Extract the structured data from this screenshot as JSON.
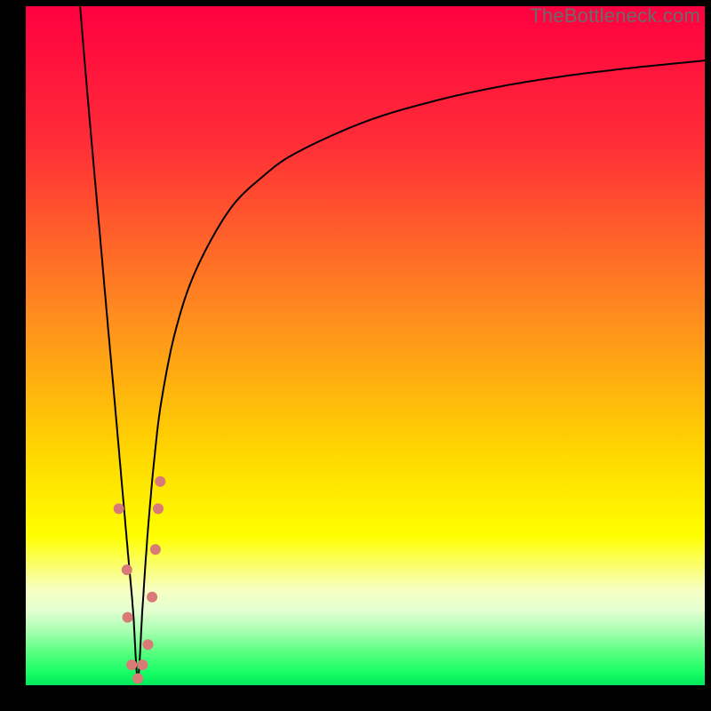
{
  "watermark": "TheBottleneck.com",
  "background": {
    "black": "#000000"
  },
  "chart_data": {
    "type": "line",
    "title": "",
    "xlabel": "",
    "ylabel": "",
    "xlim": [
      0,
      100
    ],
    "ylim": [
      0,
      100
    ],
    "bottleneck_x": 16.5,
    "gradient_stops": [
      {
        "pct": 0,
        "color": "#ff0040"
      },
      {
        "pct": 20,
        "color": "#ff2d37"
      },
      {
        "pct": 45,
        "color": "#ff8a1f"
      },
      {
        "pct": 65,
        "color": "#ffd400"
      },
      {
        "pct": 78,
        "color": "#ffff00"
      },
      {
        "pct": 82,
        "color": "#fbff63"
      },
      {
        "pct": 86,
        "color": "#f6ffc3"
      },
      {
        "pct": 89,
        "color": "#e3ffd0"
      },
      {
        "pct": 92,
        "color": "#a8ffb2"
      },
      {
        "pct": 95,
        "color": "#5cff82"
      },
      {
        "pct": 98,
        "color": "#1aff66"
      },
      {
        "pct": 100,
        "color": "#00e85a"
      }
    ],
    "series": [
      {
        "name": "bottleneck-curve",
        "color": "#000000",
        "x": [
          8,
          9,
          10,
          11,
          12,
          13,
          14,
          15,
          15.8,
          16.5,
          17.2,
          18,
          19,
          20,
          22,
          25,
          30,
          35,
          40,
          50,
          60,
          70,
          80,
          90,
          100
        ],
        "y": [
          100,
          88,
          76.6,
          65.4,
          54,
          42.8,
          31.4,
          20,
          11,
          1,
          11.5,
          23,
          34,
          42,
          52,
          61,
          70,
          75,
          78.5,
          83,
          86,
          88.2,
          89.8,
          91,
          92
        ]
      }
    ],
    "markers": {
      "name": "data-points",
      "color": "#d87b77",
      "radius_px": 6,
      "points": [
        {
          "x": 13.7,
          "y": 26
        },
        {
          "x": 14.9,
          "y": 17
        },
        {
          "x": 15.0,
          "y": 10
        },
        {
          "x": 15.6,
          "y": 3
        },
        {
          "x": 16.5,
          "y": 1
        },
        {
          "x": 17.2,
          "y": 3
        },
        {
          "x": 18.0,
          "y": 6
        },
        {
          "x": 18.6,
          "y": 13
        },
        {
          "x": 19.1,
          "y": 20
        },
        {
          "x": 19.5,
          "y": 26
        },
        {
          "x": 19.8,
          "y": 30
        }
      ]
    }
  }
}
